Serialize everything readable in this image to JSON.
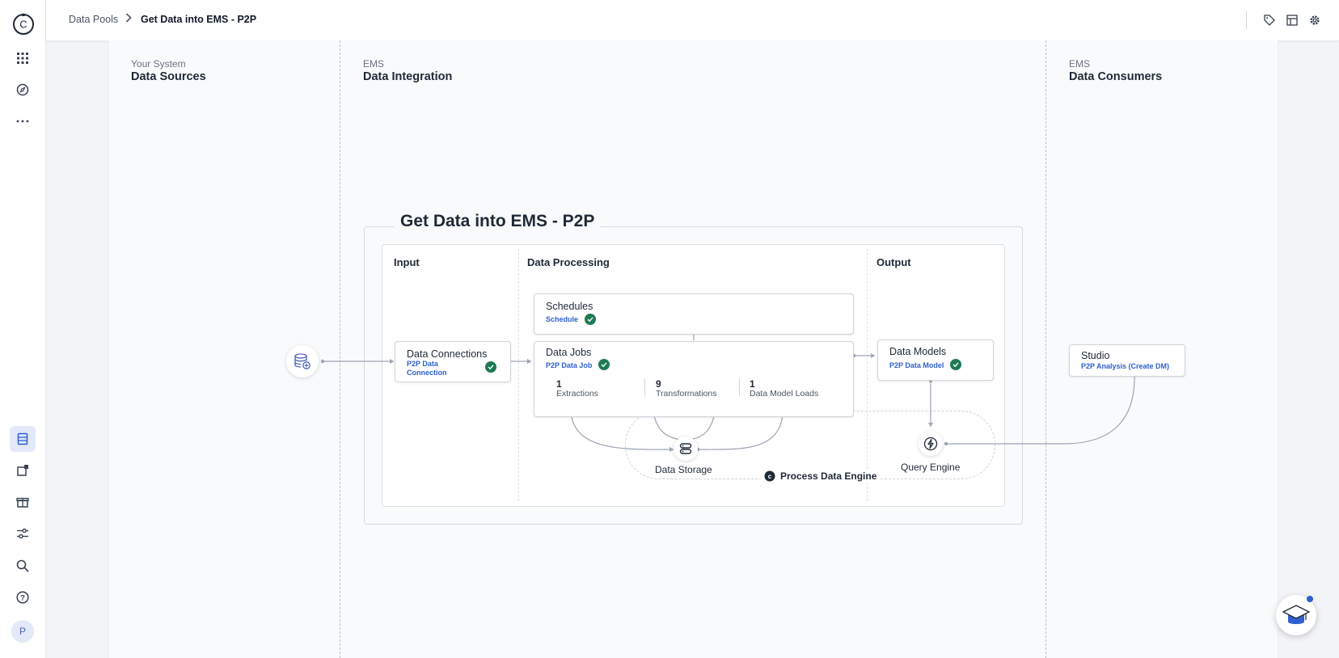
{
  "breadcrumb": {
    "root": "Data Pools",
    "current": "Get Data into EMS - P2P"
  },
  "sidebar": {
    "logo": "C",
    "user_initial": "P",
    "icons": [
      "apps-grid-icon",
      "compass-icon",
      "more-icon",
      "data-icon",
      "new-package-icon",
      "gift-icon",
      "sliders-icon",
      "search-icon",
      "help-icon"
    ]
  },
  "columns": {
    "sources": {
      "subtitle": "Your System",
      "title": "Data Sources"
    },
    "integration": {
      "subtitle": "EMS",
      "title": "Data Integration"
    },
    "consumers": {
      "subtitle": "EMS",
      "title": "Data Consumers"
    }
  },
  "diagram": {
    "title": "Get Data into EMS - P2P",
    "sections": {
      "input": "Input",
      "processing": "Data Processing",
      "output": "Output"
    },
    "data_connections": {
      "title": "Data Connections",
      "link": "P2P Data Connection"
    },
    "schedules": {
      "title": "Schedules",
      "link": "Schedule"
    },
    "data_jobs": {
      "title": "Data Jobs",
      "link": "P2P Data Job",
      "stats": [
        {
          "value": "1",
          "label": "Extractions"
        },
        {
          "value": "9",
          "label": "Transformations"
        },
        {
          "value": "1",
          "label": "Data Model Loads"
        }
      ]
    },
    "data_models": {
      "title": "Data Models",
      "link": "P2P Data Model"
    },
    "studio": {
      "title": "Studio",
      "link": "P2P Analysis (Create DM)"
    },
    "data_storage": "Data Storage",
    "query_engine": "Query Engine",
    "engine": "Process Data Engine"
  },
  "colors": {
    "accent": "#2f5fd0",
    "success": "#1f7a54",
    "line": "#9ca3b4"
  }
}
